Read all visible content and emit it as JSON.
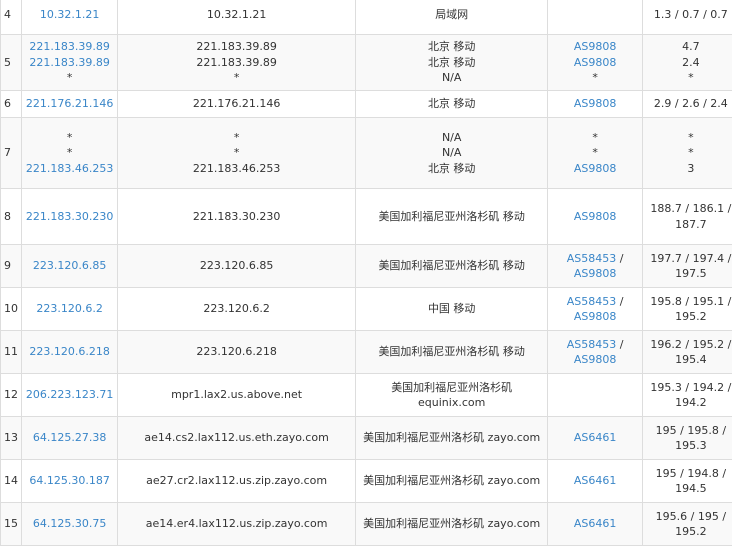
{
  "colors": {
    "link": "#3a86c8",
    "text": "#333333",
    "border": "#dddddd",
    "row_alt": "#f9f9f9"
  },
  "rows": [
    {
      "hop": "4",
      "ip": [
        "10.32.1.21"
      ],
      "host": [
        "10.32.1.21"
      ],
      "location": [
        "局域网"
      ],
      "asn": [
        []
      ],
      "rtt": [
        "1.3 / 0.7 / 0.7"
      ]
    },
    {
      "hop": "5",
      "ip": [
        "221.183.39.89",
        "221.183.39.89",
        "*"
      ],
      "host": [
        "221.183.39.89",
        "221.183.39.89",
        "*"
      ],
      "location": [
        "北京 移动",
        "北京 移动",
        "N/A"
      ],
      "asn": [
        [
          "AS9808"
        ],
        [
          "AS9808"
        ],
        [
          "*"
        ]
      ],
      "rtt": [
        "4.7",
        "2.4",
        "*"
      ]
    },
    {
      "hop": "6",
      "ip": [
        "221.176.21.146"
      ],
      "host": [
        "221.176.21.146"
      ],
      "location": [
        "北京 移动"
      ],
      "asn": [
        [
          "AS9808"
        ]
      ],
      "rtt": [
        "2.9 / 2.6 / 2.4"
      ]
    },
    {
      "hop": "7",
      "ip": [
        "*",
        "*",
        "221.183.46.253"
      ],
      "host": [
        "*",
        "*",
        "221.183.46.253"
      ],
      "location": [
        "N/A",
        "N/A",
        "北京 移动"
      ],
      "asn": [
        [
          "*"
        ],
        [
          "*"
        ],
        [
          "AS9808"
        ]
      ],
      "rtt": [
        "*",
        "*",
        "3"
      ]
    },
    {
      "hop": "8",
      "ip": [
        "221.183.30.230"
      ],
      "host": [
        "221.183.30.230"
      ],
      "location": [
        "美国加利福尼亚州洛杉矶 移动"
      ],
      "asn": [
        [
          "AS9808"
        ]
      ],
      "rtt": [
        "188.7 / 186.1 /",
        "187.7"
      ]
    },
    {
      "hop": "9",
      "ip": [
        "223.120.6.85"
      ],
      "host": [
        "223.120.6.85"
      ],
      "location": [
        "美国加利福尼亚州洛杉矶 移动"
      ],
      "asn": [
        [
          "AS58453",
          "AS9808"
        ]
      ],
      "rtt": [
        "197.7 / 197.4 /",
        "197.5"
      ]
    },
    {
      "hop": "10",
      "ip": [
        "223.120.6.2"
      ],
      "host": [
        "223.120.6.2"
      ],
      "location": [
        "中国 移动"
      ],
      "asn": [
        [
          "AS58453",
          "AS9808"
        ]
      ],
      "rtt": [
        "195.8 / 195.1 /",
        "195.2"
      ]
    },
    {
      "hop": "11",
      "ip": [
        "223.120.6.218"
      ],
      "host": [
        "223.120.6.218"
      ],
      "location": [
        "美国加利福尼亚州洛杉矶 移动"
      ],
      "asn": [
        [
          "AS58453",
          "AS9808"
        ]
      ],
      "rtt": [
        "196.2 / 195.2 /",
        "195.4"
      ]
    },
    {
      "hop": "12",
      "ip": [
        "206.223.123.71"
      ],
      "host": [
        "mpr1.lax2.us.above.net"
      ],
      "location": [
        "美国加利福尼亚州洛杉矶",
        "equinix.com"
      ],
      "asn": [
        []
      ],
      "rtt": [
        "195.3 / 194.2 /",
        "194.2"
      ]
    },
    {
      "hop": "13",
      "ip": [
        "64.125.27.38"
      ],
      "host": [
        "ae14.cs2.lax112.us.eth.zayo.com"
      ],
      "location": [
        "美国加利福尼亚州洛杉矶 zayo.com"
      ],
      "asn": [
        [
          "AS6461"
        ]
      ],
      "rtt": [
        "195 / 195.8 /",
        "195.3"
      ]
    },
    {
      "hop": "14",
      "ip": [
        "64.125.30.187"
      ],
      "host": [
        "ae27.cr2.lax112.us.zip.zayo.com"
      ],
      "location": [
        "美国加利福尼亚州洛杉矶 zayo.com"
      ],
      "asn": [
        [
          "AS6461"
        ]
      ],
      "rtt": [
        "195 / 194.8 /",
        "194.5"
      ]
    },
    {
      "hop": "15",
      "ip": [
        "64.125.30.75"
      ],
      "host": [
        "ae14.er4.lax112.us.zip.zayo.com"
      ],
      "location": [
        "美国加利福尼亚州洛杉矶 zayo.com"
      ],
      "asn": [
        [
          "AS6461"
        ]
      ],
      "rtt": [
        "195.6 / 195 /",
        "195.2"
      ]
    }
  ]
}
